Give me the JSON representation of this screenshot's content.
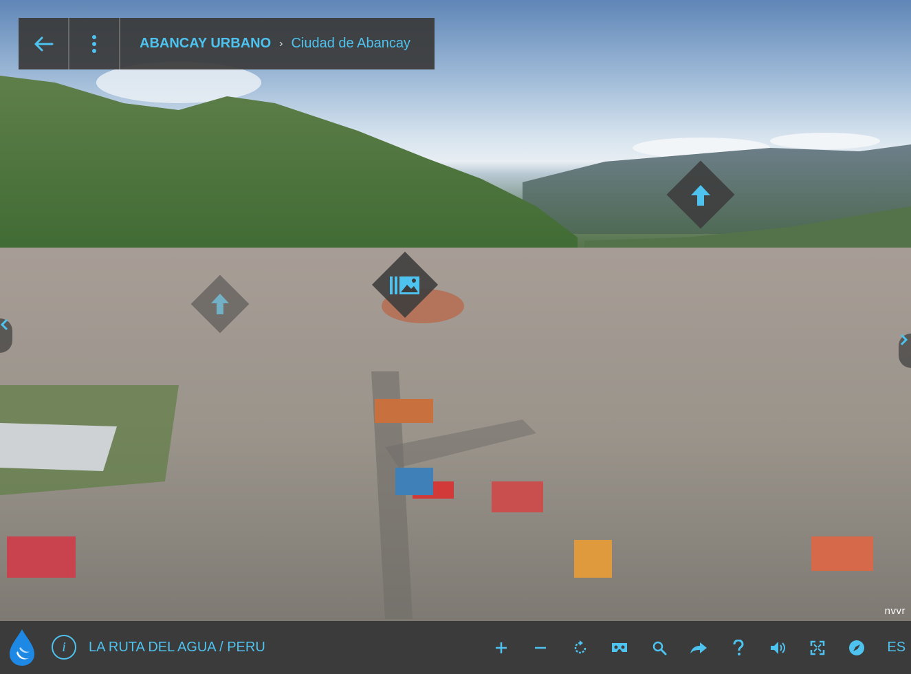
{
  "header": {
    "back_icon": "arrow-left-icon",
    "menu_icon": "kebab-menu-icon",
    "project_title": "ABANCAY URBANO",
    "separator": "›",
    "scene_title": "Ciudad de Abancay"
  },
  "hotspots": [
    {
      "name": "hotspot-up-arrow-right",
      "icon": "arrow-up-icon"
    },
    {
      "name": "hotspot-gallery",
      "icon": "gallery-icon"
    },
    {
      "name": "hotspot-up-arrow-left",
      "icon": "arrow-up-icon"
    }
  ],
  "edge_nav": {
    "left_icon": "chevron-left-icon",
    "right_icon": "chevron-right-icon"
  },
  "watermark": "nvvr",
  "footer": {
    "logo_icon": "water-drop-logo",
    "info_label": "i",
    "brand_text": "LA RUTA DEL AGUA / PERU",
    "tools": [
      {
        "name": "zoom-in-button",
        "icon": "plus-icon",
        "text": "+"
      },
      {
        "name": "zoom-out-button",
        "icon": "minus-icon",
        "text": "−"
      },
      {
        "name": "autorotate-button",
        "icon": "rotate-icon"
      },
      {
        "name": "vr-button",
        "icon": "vr-headset-icon"
      },
      {
        "name": "search-button",
        "icon": "search-icon"
      },
      {
        "name": "share-button",
        "icon": "share-arrow-icon"
      },
      {
        "name": "help-button",
        "icon": "question-icon",
        "text": "?"
      },
      {
        "name": "sound-button",
        "icon": "speaker-icon"
      },
      {
        "name": "fullscreen-button",
        "icon": "fullscreen-icon"
      },
      {
        "name": "compass-button",
        "icon": "compass-icon"
      }
    ],
    "language": "ES"
  },
  "colors": {
    "accent": "#4fc3ef",
    "bar_bg": "#3b3b3b"
  }
}
